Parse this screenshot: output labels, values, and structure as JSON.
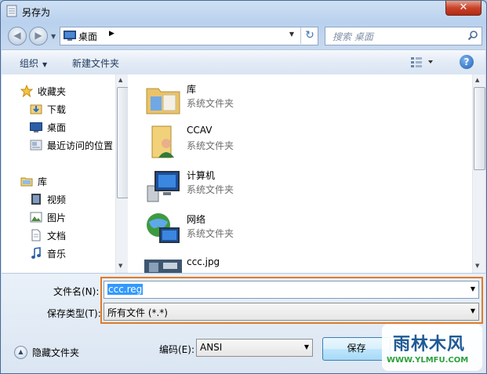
{
  "window": {
    "title": "另存为",
    "close_label": "✕"
  },
  "nav": {
    "back_label": "◀",
    "forward_label": "▶",
    "address": "桌面",
    "address_arrow": "▶",
    "search_placeholder": "搜索 桌面"
  },
  "toolbar": {
    "organize": "组织",
    "new_folder": "新建文件夹",
    "help": "?"
  },
  "sidebar": {
    "favorites_header": "收藏夹",
    "favorites": [
      "下载",
      "桌面",
      "最近访问的位置"
    ],
    "libraries_header": "库",
    "libraries": [
      "视频",
      "图片",
      "文档",
      "音乐"
    ]
  },
  "files": [
    {
      "name": "库",
      "type": "系统文件夹",
      "icon": "library-icon"
    },
    {
      "name": "CCAV",
      "type": "系统文件夹",
      "icon": "user-folder-icon"
    },
    {
      "name": "计算机",
      "type": "系统文件夹",
      "icon": "computer-icon"
    },
    {
      "name": "网络",
      "type": "系统文件夹",
      "icon": "network-icon"
    },
    {
      "name": "ccc.jpg",
      "type": "",
      "icon": "image-thumb-icon"
    }
  ],
  "form": {
    "filename_label": "文件名(N):",
    "filename_value": "ccc.reg",
    "savetype_label": "保存类型(T):",
    "savetype_value": "所有文件  (*.*)",
    "encoding_label": "编码(E):",
    "encoding_value": "ANSI",
    "save_button": "保存",
    "hide_folders": "隐藏文件夹"
  },
  "watermark": {
    "brand": "雨林木风",
    "url": "WWW.YLMFU.COM"
  }
}
